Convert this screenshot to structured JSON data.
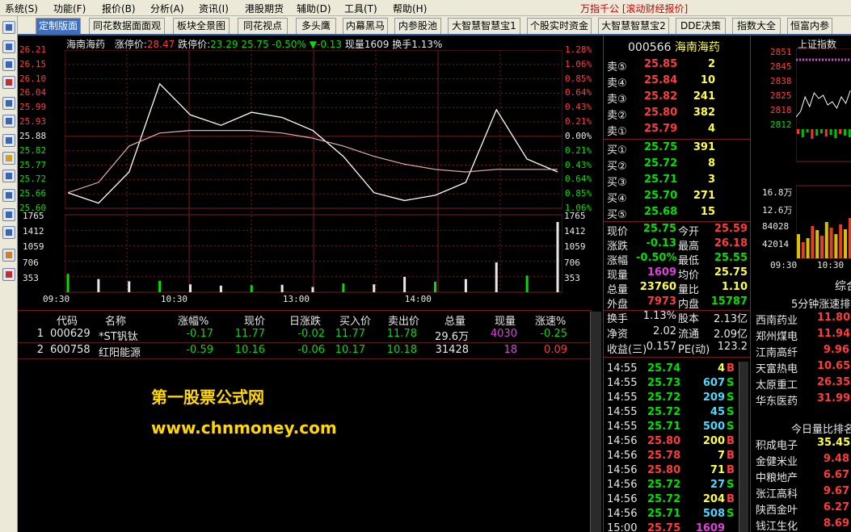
{
  "menu": {
    "items": [
      "系统(S)",
      "功能(F)",
      "报价(B)",
      "分析(A)",
      "资讯(I)",
      "港股期货",
      "辅助(D)",
      "工具(T)",
      "帮助(H)"
    ],
    "brand": "万指千公 [滚动财经报价]"
  },
  "tabs": [
    "定制版面",
    "同花数据面面观",
    "板块全景图",
    "同花视点",
    "多头鹰",
    "内幕黑马",
    "内参股池",
    "大智慧智慧宝1",
    "个股实时资金",
    "大智慧智慧宝2",
    "DDE决策",
    "指数大全",
    "恒富内参"
  ],
  "intraday": {
    "stock_name": "海南海药",
    "limit_up_label": "涨停价:",
    "limit_up": "28.47",
    "limit_down_label": "跌停价:",
    "limit_down": "23.29",
    "price": "25.75",
    "pct": "-0.50%",
    "change": "▼-0.13",
    "vol_label": "现量",
    "vol": "1609",
    "turnover_label": "换手",
    "turnover": "1.13%",
    "price_labels": [
      "26.21",
      "26.15",
      "26.10",
      "26.04",
      "25.99",
      "25.93",
      "25.88",
      "25.82",
      "25.77",
      "25.72",
      "25.66",
      "25.60"
    ],
    "pct_labels": [
      "1.28%",
      "1.06%",
      "0.85%",
      "0.64%",
      "0.43%",
      "0.21%",
      "0.00%",
      "0.21%",
      "0.43%",
      "0.64%",
      "0.85%",
      "1.06%"
    ],
    "vol_labels": [
      "1765",
      "1412",
      "1059",
      "706",
      "353"
    ],
    "time_labels": [
      "09:30",
      "10:30",
      "13:00",
      "14:00"
    ]
  },
  "chart_data": {
    "type": "line",
    "title": "海南海药",
    "x": [
      "09:30",
      "09:45",
      "10:00",
      "10:15",
      "10:30",
      "10:45",
      "11:00",
      "11:15",
      "11:30",
      "13:15",
      "13:30",
      "13:45",
      "14:00",
      "14:15",
      "14:30",
      "14:45",
      "15:00"
    ],
    "series": [
      {
        "name": "现价",
        "values": [
          25.66,
          25.62,
          25.74,
          26.08,
          25.96,
          25.92,
          25.97,
          25.95,
          25.9,
          25.8,
          25.66,
          25.63,
          25.65,
          25.7,
          25.98,
          25.79,
          25.74
        ]
      },
      {
        "name": "均价",
        "values": [
          25.66,
          25.7,
          25.84,
          25.89,
          25.9,
          25.9,
          25.9,
          25.89,
          25.87,
          25.84,
          25.8,
          25.77,
          25.75,
          25.74,
          25.75,
          25.75,
          25.75
        ]
      }
    ],
    "volume": [
      420,
      300,
      250,
      260,
      180,
      150,
      160,
      170,
      120,
      200,
      180,
      350,
      240,
      300,
      680,
      380,
      1600
    ],
    "ylim": [
      25.6,
      26.21
    ],
    "vol_max": 1765,
    "grid": true
  },
  "table": {
    "headers": [
      "代码",
      "名称",
      "涨幅%",
      "现价",
      "日涨跌",
      "买入价",
      "卖出价",
      "总量",
      "现量",
      "涨速%"
    ],
    "rows": [
      {
        "idx": "1",
        "code": "000629",
        "name": "*ST钒钛",
        "pct": "-0.17",
        "price": "11.77",
        "chg": "-0.02",
        "bid": "11.77",
        "ask": "11.78",
        "vol": "29.6万",
        "cur": "4030",
        "speed": "-0.25"
      },
      {
        "idx": "2",
        "code": "600758",
        "name": "红阳能源",
        "pct": "-0.59",
        "price": "10.16",
        "chg": "-0.06",
        "bid": "10.17",
        "ask": "10.18",
        "vol": "31428",
        "cur": "18",
        "speed": "0.09"
      }
    ]
  },
  "watermark": {
    "line1": "第一股票公式网",
    "line2": "www.chnmoney.com"
  },
  "quote": {
    "code": "000566",
    "name": "海南海药",
    "asks": [
      {
        "l": "卖⑤",
        "p": "25.85",
        "v": "2"
      },
      {
        "l": "卖④",
        "p": "25.84",
        "v": "10"
      },
      {
        "l": "卖③",
        "p": "25.82",
        "v": "241"
      },
      {
        "l": "卖②",
        "p": "25.80",
        "v": "382"
      },
      {
        "l": "卖①",
        "p": "25.79",
        "v": "4"
      }
    ],
    "bids": [
      {
        "l": "买①",
        "p": "25.75",
        "v": "391"
      },
      {
        "l": "买②",
        "p": "25.72",
        "v": "8"
      },
      {
        "l": "买③",
        "p": "25.71",
        "v": "3"
      },
      {
        "l": "买④",
        "p": "25.70",
        "v": "271"
      },
      {
        "l": "买⑤",
        "p": "25.68",
        "v": "15"
      }
    ],
    "stats": [
      {
        "a": "现价",
        "av": "25.75",
        "b": "今开",
        "bv": "25.59"
      },
      {
        "a": "涨跌",
        "av": "-0.13",
        "b": "最高",
        "bv": "26.18"
      },
      {
        "a": "涨幅",
        "av": "-0.50%",
        "b": "最低",
        "bv": "25.55"
      },
      {
        "a": "现量",
        "av": "1609",
        "b": "均价",
        "bv": "25.75"
      },
      {
        "a": "总量",
        "av": "23760",
        "b": "量比",
        "bv": "1.10"
      },
      {
        "a": "外盘",
        "av": "7973",
        "b": "内盘",
        "bv": "15787"
      }
    ],
    "stats2": [
      {
        "a": "换手",
        "av": "1.13%",
        "b": "股本",
        "bv": "2.13亿"
      },
      {
        "a": "净资",
        "av": "2.02",
        "b": "流通",
        "bv": "2.09亿"
      },
      {
        "a": "收益(三)",
        "av": "0.157",
        "b": "PE(动)",
        "bv": "123.2"
      }
    ],
    "ticks": [
      {
        "t": "14:55",
        "p": "25.74",
        "v": "4",
        "s": "B"
      },
      {
        "t": "14:55",
        "p": "25.73",
        "v": "607",
        "s": "S"
      },
      {
        "t": "14:55",
        "p": "25.72",
        "v": "209",
        "s": "S"
      },
      {
        "t": "14:55",
        "p": "25.72",
        "v": "45",
        "s": "S"
      },
      {
        "t": "14:55",
        "p": "25.71",
        "v": "500",
        "s": "S"
      },
      {
        "t": "14:56",
        "p": "25.80",
        "v": "200",
        "s": "B"
      },
      {
        "t": "14:56",
        "p": "25.78",
        "v": "7",
        "s": "B"
      },
      {
        "t": "14:56",
        "p": "25.80",
        "v": "71",
        "s": "B"
      },
      {
        "t": "14:56",
        "p": "25.72",
        "v": "27",
        "s": "S"
      },
      {
        "t": "14:56",
        "p": "25.72",
        "v": "204",
        "s": "B"
      },
      {
        "t": "14:56",
        "p": "25.71",
        "v": "508",
        "s": "S"
      },
      {
        "t": "15:00",
        "p": "25.75",
        "v": "1609",
        "s": ""
      }
    ]
  },
  "mini": {
    "index_label": "上证指数",
    "price_labels": [
      "2851",
      "2845",
      "2838",
      "2825",
      "2818",
      "2812"
    ],
    "vol_labels": [
      "16.8万",
      "12.6万",
      "84028",
      "42014"
    ],
    "time_labels": [
      "09:30",
      "10:30"
    ],
    "title1": "综合",
    "section1": "5分钟涨速排名",
    "list1": [
      {
        "n": "西南药业",
        "v": "11.80"
      },
      {
        "n": "郑州煤电",
        "v": "11.94"
      },
      {
        "n": "江南高纤",
        "v": "9.96"
      },
      {
        "n": "天富热电",
        "v": "10.65"
      },
      {
        "n": "太原重工",
        "v": "26.35"
      },
      {
        "n": "华东医药",
        "v": "31.99"
      }
    ],
    "section2": "今日量比排名",
    "list2": [
      {
        "n": "积成电子",
        "v": "35.45"
      },
      {
        "n": "金健米业",
        "v": "9.48"
      },
      {
        "n": "中粮地产",
        "v": "6.67"
      },
      {
        "n": "张江高科",
        "v": "9.67"
      },
      {
        "n": "陕西金叶",
        "v": "6.27"
      },
      {
        "n": "钱江生化",
        "v": "8.69"
      }
    ]
  },
  "colors": {
    "up": "#ff3c3c",
    "down": "#00e000",
    "price_line": "#ffffff",
    "avg_line": "#e0b0b0",
    "grid": "#7a1c1c"
  }
}
